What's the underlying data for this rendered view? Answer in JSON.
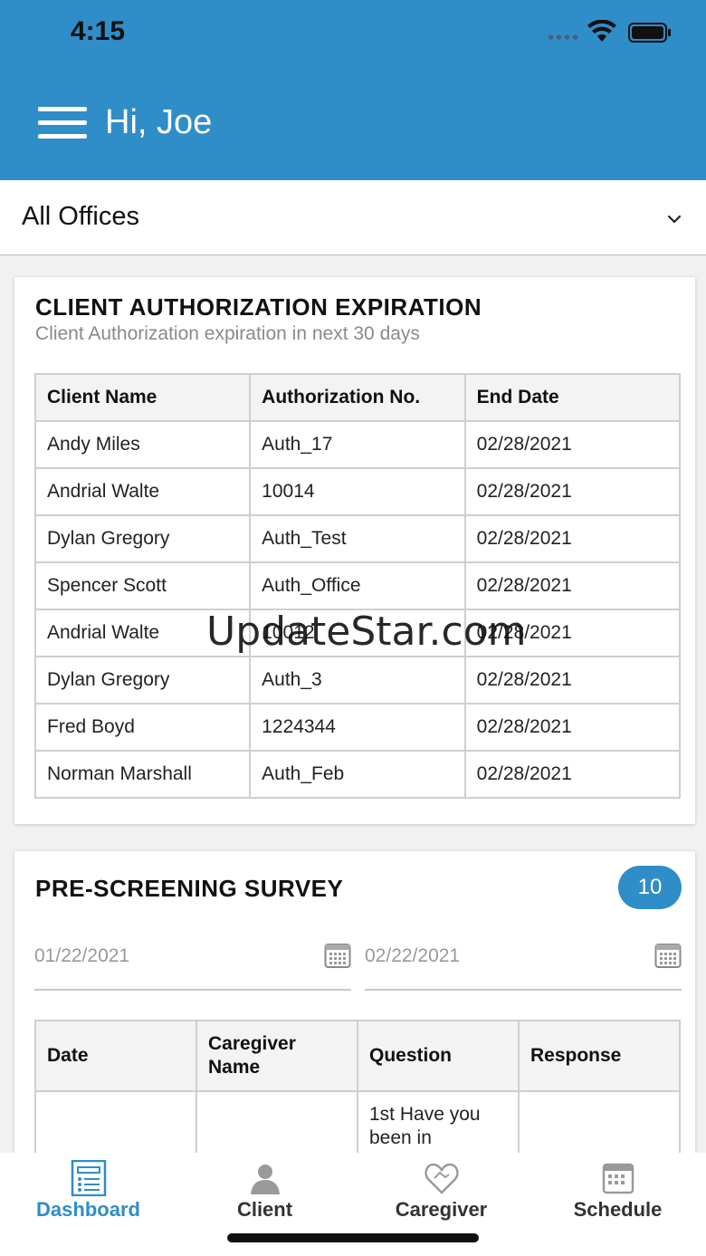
{
  "status_bar": {
    "time": "4:15"
  },
  "header": {
    "greeting": "Hi, Joe"
  },
  "office_selector": {
    "selected": "All Offices"
  },
  "auth_card": {
    "title": "CLIENT AUTHORIZATION EXPIRATION",
    "subtitle": "Client Authorization expiration in next 30 days",
    "columns": [
      "Client Name",
      "Authorization No.",
      "End Date"
    ],
    "rows": [
      [
        "Andy Miles",
        "Auth_17",
        "02/28/2021"
      ],
      [
        "Andrial Walte",
        "10014",
        "02/28/2021"
      ],
      [
        "Dylan Gregory",
        "Auth_Test",
        "02/28/2021"
      ],
      [
        "Spencer Scott",
        "Auth_Office",
        "02/28/2021"
      ],
      [
        "Andrial Walte",
        "10012",
        "02/28/2021"
      ],
      [
        "Dylan Gregory",
        "Auth_3",
        "02/28/2021"
      ],
      [
        "Fred Boyd",
        "1224344",
        "02/28/2021"
      ],
      [
        "Norman Marshall",
        "Auth_Feb",
        "02/28/2021"
      ]
    ]
  },
  "survey_card": {
    "title": "PRE-SCREENING SURVEY",
    "count": "10",
    "start_date": "01/22/2021",
    "end_date": "02/22/2021",
    "columns": [
      "Date",
      "Caregiver Name",
      "Question",
      "Response"
    ],
    "rows": [
      [
        "",
        "",
        "1st Have you been in",
        ""
      ]
    ]
  },
  "bottom_nav": {
    "items": [
      {
        "label": "Dashboard",
        "icon": "dashboard-icon",
        "active": true
      },
      {
        "label": "Client",
        "icon": "client-icon",
        "active": false
      },
      {
        "label": "Caregiver",
        "icon": "caregiver-icon",
        "active": false
      },
      {
        "label": "Schedule",
        "icon": "schedule-icon",
        "active": false
      }
    ]
  },
  "watermark": "UpdateStar.com",
  "colors": {
    "primary": "#2f8dc8",
    "background": "#f1f1f1"
  }
}
